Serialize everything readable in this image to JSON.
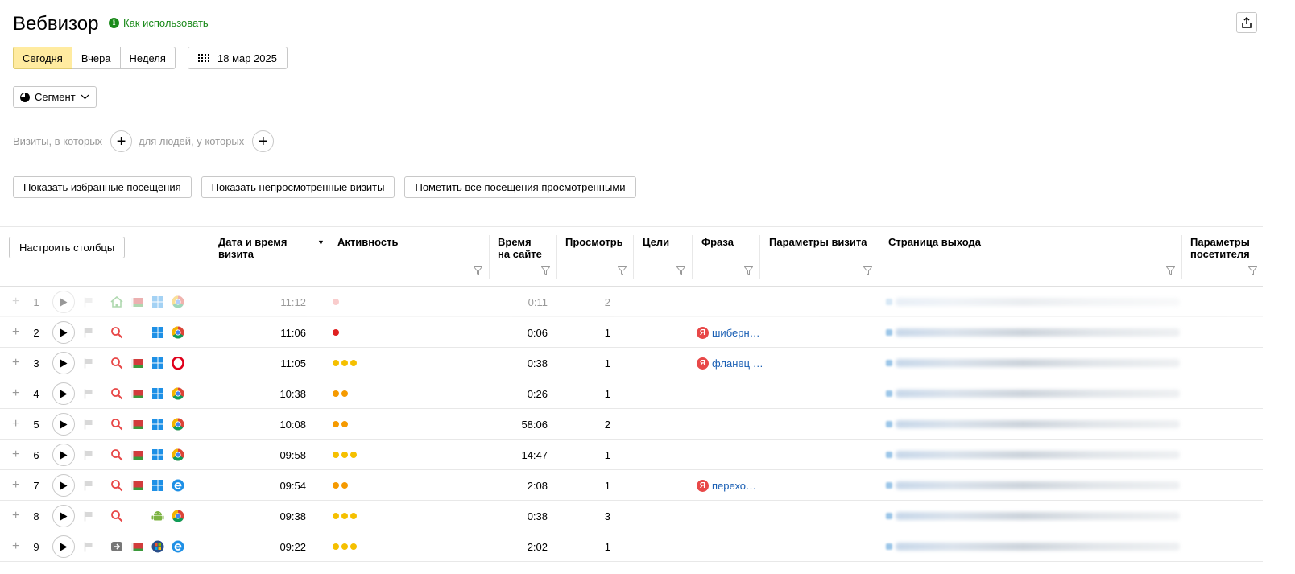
{
  "header": {
    "title": "Вебвизор",
    "howto_label": "Как использовать",
    "howto_icon": "info-icon",
    "export_icon": "export-icon"
  },
  "period": {
    "today": "Сегодня",
    "yesterday": "Вчера",
    "week": "Неделя",
    "active": "today",
    "date_label": "18 мар 2025"
  },
  "segment": {
    "label": "Сегмент"
  },
  "filters": {
    "visits_where": "Визиты, в которых",
    "people_where": "для людей, у которых"
  },
  "actions": {
    "show_favorites": "Показать избранные посещения",
    "show_unviewed": "Показать непросмотренные визиты",
    "mark_all_viewed": "Пометить все посещения просмотренными"
  },
  "table": {
    "configure_columns": "Настроить столбцы",
    "columns": {
      "datetime": "Дата и время визита",
      "activity": "Активность",
      "duration": "Время на сайте",
      "views": "Просмотры",
      "goals": "Цели",
      "phrase": "Фраза",
      "visit_params": "Параметры визита",
      "exit_page": "Страница выхода",
      "visitor_params": "Параметры посетителя"
    },
    "sort_indicator": "▼",
    "rows": [
      {
        "n": "1",
        "time": "11:12",
        "activity": [
          "#f08080"
        ],
        "duration": "0:11",
        "views": "2",
        "phrase": "",
        "source": "home-icon",
        "geo": "flag-icon",
        "os": "windows-icon",
        "browser": "chrome-icon",
        "faded": true
      },
      {
        "n": "2",
        "time": "11:06",
        "activity": [
          "#e02020"
        ],
        "duration": "0:06",
        "views": "1",
        "phrase": "шиберн…",
        "source": "search-icon",
        "geo": "",
        "os": "windows-icon",
        "browser": "chrome-icon",
        "faded": false
      },
      {
        "n": "3",
        "time": "11:05",
        "activity": [
          "#f5c000",
          "#f5c000",
          "#f5c000"
        ],
        "duration": "0:38",
        "views": "1",
        "phrase": "фланец …",
        "source": "search-icon",
        "geo": "flag-icon",
        "os": "windows-icon",
        "browser": "opera-icon",
        "faded": false
      },
      {
        "n": "4",
        "time": "10:38",
        "activity": [
          "#f59a00",
          "#f59a00"
        ],
        "duration": "0:26",
        "views": "1",
        "phrase": "",
        "source": "search-icon",
        "geo": "flag-icon",
        "os": "windows-icon",
        "browser": "chrome-icon",
        "faded": false
      },
      {
        "n": "5",
        "time": "10:08",
        "activity": [
          "#f59a00",
          "#f59a00"
        ],
        "duration": "58:06",
        "views": "2",
        "phrase": "",
        "source": "search-icon",
        "geo": "flag-icon",
        "os": "windows-icon",
        "browser": "chrome-icon",
        "faded": false
      },
      {
        "n": "6",
        "time": "09:58",
        "activity": [
          "#f5c000",
          "#f5c000",
          "#f5c000"
        ],
        "duration": "14:47",
        "views": "1",
        "phrase": "",
        "source": "search-icon",
        "geo": "flag-icon",
        "os": "windows-icon",
        "browser": "chrome-icon",
        "faded": false
      },
      {
        "n": "7",
        "time": "09:54",
        "activity": [
          "#f59a00",
          "#f59a00"
        ],
        "duration": "2:08",
        "views": "1",
        "phrase": "перехо…",
        "source": "search-icon",
        "geo": "flag-icon",
        "os": "windows-icon",
        "browser": "edge-icon",
        "faded": false
      },
      {
        "n": "8",
        "time": "09:38",
        "activity": [
          "#f5c000",
          "#f5c000",
          "#f5c000"
        ],
        "duration": "0:38",
        "views": "3",
        "phrase": "",
        "source": "search-icon",
        "geo": "",
        "os": "android-icon",
        "browser": "chrome-icon",
        "faded": false
      },
      {
        "n": "9",
        "time": "09:22",
        "activity": [
          "#f5c000",
          "#f5c000",
          "#f5c000"
        ],
        "duration": "2:02",
        "views": "1",
        "phrase": "",
        "source": "direct-icon",
        "geo": "flag-icon",
        "os": "windows7-icon",
        "browser": "edge-icon",
        "faded": false
      }
    ]
  },
  "colors": {
    "accent_active": "#ffeba0",
    "link_green": "#1a8a1a",
    "phrase_link": "#1a5fb4",
    "yandex_red": "#e84848"
  }
}
